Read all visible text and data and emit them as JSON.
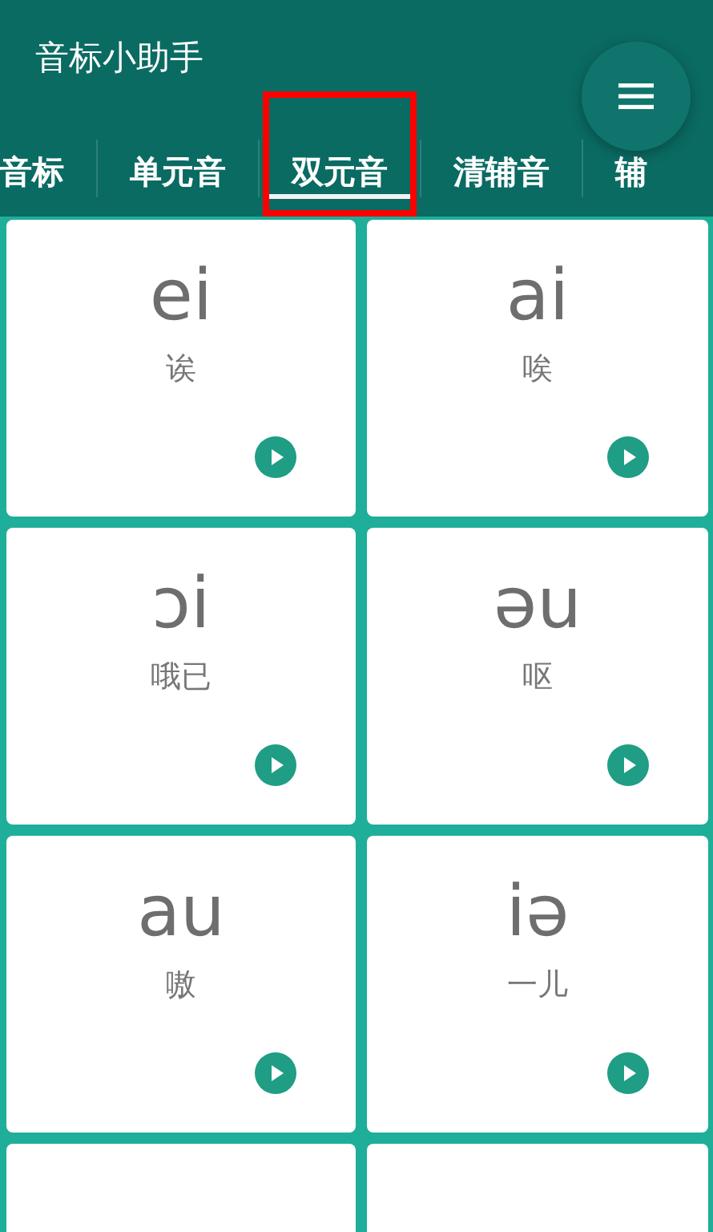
{
  "app_bar": {
    "title": "音标小助手"
  },
  "tabs": [
    {
      "label": "音标",
      "selected": false,
      "marked": false
    },
    {
      "label": "单元音",
      "selected": false,
      "marked": false
    },
    {
      "label": "双元音",
      "selected": true,
      "marked": true
    },
    {
      "label": "清辅音",
      "selected": false,
      "marked": false
    },
    {
      "label": "辅",
      "selected": false,
      "marked": false
    }
  ],
  "cards": [
    {
      "symbol": "ei",
      "hint": "诶"
    },
    {
      "symbol": "ai",
      "hint": "唉"
    },
    {
      "symbol": "ɔi",
      "hint": "哦已"
    },
    {
      "symbol": "əu",
      "hint": "呕"
    },
    {
      "symbol": "au",
      "hint": "嗷"
    },
    {
      "symbol": "iə",
      "hint": "一儿"
    }
  ]
}
